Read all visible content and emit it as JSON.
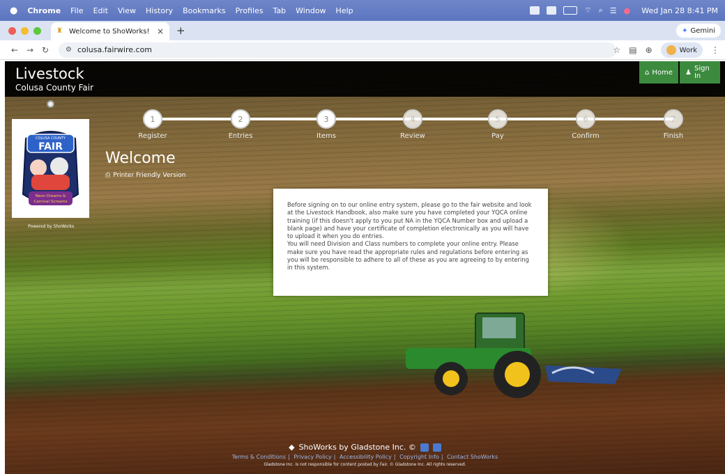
{
  "menubar": {
    "apple": "",
    "app": "Chrome",
    "items": [
      "File",
      "Edit",
      "View",
      "History",
      "Bookmarks",
      "Profiles",
      "Tab",
      "Window",
      "Help"
    ],
    "clock": "Wed Jan 28  8:41 PM"
  },
  "browser": {
    "tab_title": "Welcome to ShoWorks!",
    "tab_close": "×",
    "new_tab": "+",
    "gemini": "Gemini",
    "url": "colusa.fairwire.com",
    "profile": "Work"
  },
  "site": {
    "title": "Livestock",
    "subtitle": "Colusa County Fair",
    "home_label": "Home",
    "signin_label": "Sign In",
    "powered_by": "Powered by ShoWorks",
    "logo_lines": [
      "COLUSA COUNTY",
      "FAIR",
      "Neon Dreams &",
      "Carnival Screams"
    ]
  },
  "steps": [
    {
      "num": "1",
      "label": "Register"
    },
    {
      "num": "2",
      "label": "Entries"
    },
    {
      "num": "3",
      "label": "Items"
    },
    {
      "num": "4",
      "label": "Review"
    },
    {
      "num": "5",
      "label": "Pay"
    },
    {
      "num": "6",
      "label": "Confirm"
    },
    {
      "num": "7",
      "label": "Finish"
    }
  ],
  "main": {
    "heading": "Welcome",
    "printer_link": "Printer Friendly Version",
    "notice_p1": "Before signing on to our online entry system, please go to the fair website and look at the Livestock Handbook, also make sure you have completed your YQCA online training (if this doesn't apply to you put NA in the YQCA Number box and upload a blank page) and have your certificate of completion electronically as you will have to upload it when you do entries.",
    "notice_p2": "You will need Division and Class numbers to complete your online entry. Please make sure you have read the appropriate rules and regulations before entering as you will be responsible to adhere to all of these as you are agreeing to by entering in this system."
  },
  "footer": {
    "brand": "ShoWorks by Gladstone Inc. ©",
    "links": [
      "Terms & Conditions",
      "Privacy Policy",
      "Accessibility Policy",
      "Copyright Info",
      "Contact ShoWorks"
    ],
    "disclaimer": "Gladstone Inc. is not responsible for content posted by Fair. © Gladstone Inc. All rights reserved."
  }
}
